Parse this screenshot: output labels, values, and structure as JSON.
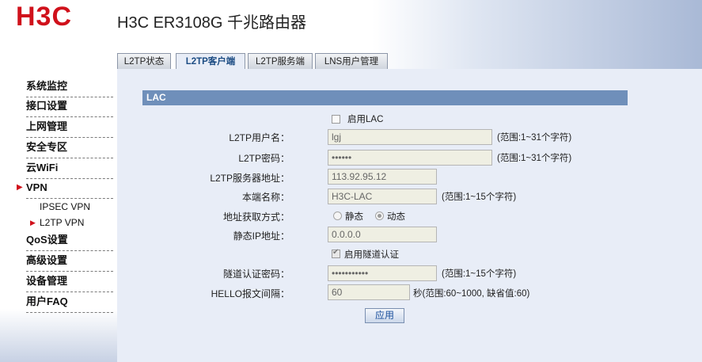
{
  "header": {
    "logo": "H3C",
    "title": "H3C ER3108G 千兆路由器"
  },
  "tabs": [
    {
      "label": "L2TP状态"
    },
    {
      "label": "L2TP客户端"
    },
    {
      "label": "L2TP服务端"
    },
    {
      "label": "LNS用户管理"
    }
  ],
  "sidebar": {
    "items": [
      {
        "label": "系统监控"
      },
      {
        "label": "接口设置"
      },
      {
        "label": "上网管理"
      },
      {
        "label": "安全专区"
      },
      {
        "label": "云WiFi"
      },
      {
        "label": "VPN"
      },
      {
        "label": "QoS设置"
      },
      {
        "label": "高级设置"
      },
      {
        "label": "设备管理"
      },
      {
        "label": "用户FAQ"
      }
    ],
    "sub_items": [
      {
        "label": "IPSEC VPN"
      },
      {
        "label": "L2TP VPN"
      }
    ]
  },
  "form": {
    "section_title": "LAC",
    "enable_lac": "启用LAC",
    "username": {
      "label": "L2TP用户名：",
      "value": "lgj",
      "hint": "(范围:1~31个字符)"
    },
    "password": {
      "label": "L2TP密码：",
      "value": "••••••",
      "hint": "(范围:1~31个字符)"
    },
    "server": {
      "label": "L2TP服务器地址：",
      "value": "113.92.95.12"
    },
    "local_name": {
      "label": "本端名称：",
      "value": "H3C-LAC",
      "hint": "(范围:1~15个字符)"
    },
    "addr_mode": {
      "label": "地址获取方式：",
      "static": "静态",
      "dynamic": "动态"
    },
    "static_ip": {
      "label": "静态IP地址：",
      "value": "0.0.0.0"
    },
    "tunnel_auth": "启用隧道认证",
    "tunnel_pwd": {
      "label": "隧道认证密码：",
      "value": "•••••••••••",
      "hint": "(范围:1~15个字符)"
    },
    "hello": {
      "label": "HELLO报文间隔：",
      "value": "60",
      "hint": "秒(范围:60~1000, 缺省值:60)"
    },
    "apply": "应用"
  },
  "colors": {
    "brand_red": "#d0111b",
    "section_blue": "#6f8fba",
    "tab_active_text": "#1d4d84"
  }
}
